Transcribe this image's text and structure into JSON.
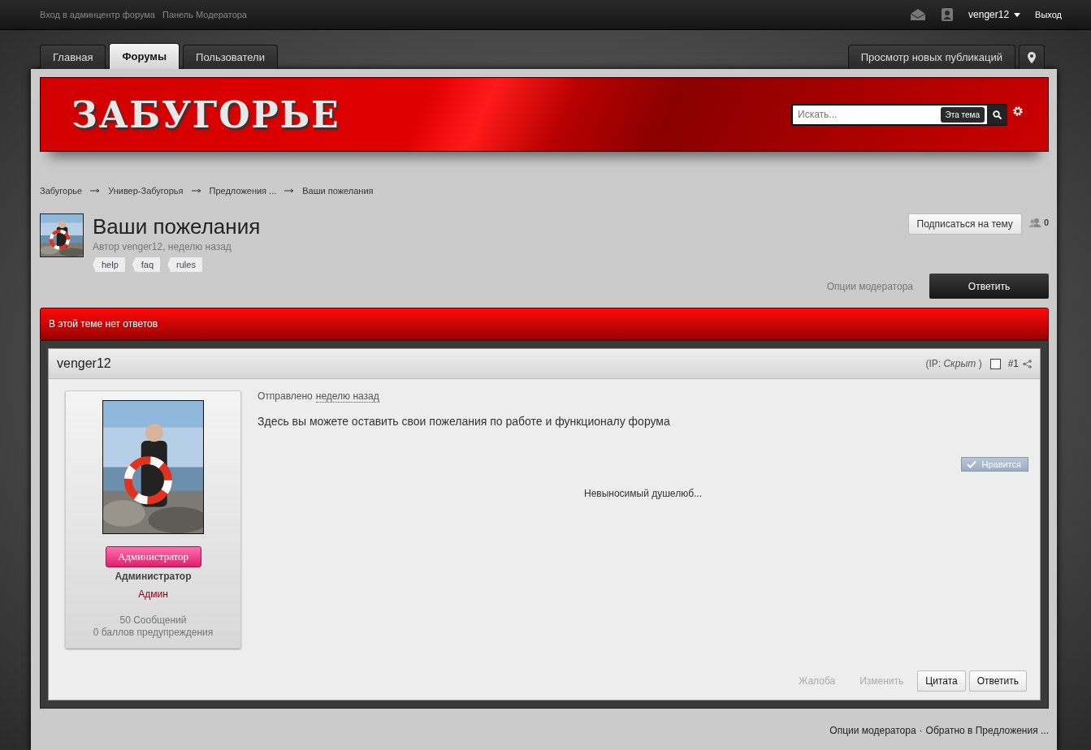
{
  "top_bar": {
    "links": [
      "Вход в админцентр форума",
      "Панель Модератора"
    ],
    "username": "venger12",
    "logout": "Выход"
  },
  "tabs": [
    {
      "label": "Главная",
      "selected": false
    },
    {
      "label": "Форумы",
      "selected": true
    },
    {
      "label": "Пользователи",
      "selected": false
    }
  ],
  "new_posts_button": "Просмотр новых публикаций",
  "header": {
    "logo": "ЗАБУГОРЬЕ",
    "search": {
      "placeholder": "Искать..."
    },
    "scope": "Эта тема"
  },
  "breadcrumbs": [
    "Забугорье",
    "Универ-Забугорья",
    "Предложения ...",
    "Ваши пожелания"
  ],
  "topic": {
    "title": "Ваши пожелания",
    "byline": "Автор venger12, неделю назад",
    "tags": [
      "help",
      "faq",
      "rules"
    ],
    "follow_button": "Подписаться на тему",
    "followers": "0",
    "mod_options": "Опции модератора",
    "reply_button": "Ответить"
  },
  "thread_bar": "В этой теме нет ответов",
  "post": {
    "author": "venger12",
    "ip": "(IP: *Скрыт* )",
    "selected": false,
    "number": "#1",
    "posted": "Отправлено",
    "posted_when": "неделю назад",
    "body": "Здесь вы можете оставить свои пожелания по работе и функционалу форума",
    "like_button": "Нравится",
    "signature": "Невыносимый душелюб...",
    "group_badge": "Администратор",
    "group": "Администратор",
    "member_title": "Админ",
    "posts_count": "50 Сообщений",
    "warnings": "0 баллов предупреждения",
    "actions": [
      {
        "label": "Жалоба",
        "kind": "link"
      },
      {
        "label": "Изменить",
        "kind": "link"
      },
      {
        "label": "Цитата",
        "kind": "button"
      },
      {
        "label": "Ответить",
        "kind": "button"
      }
    ]
  },
  "footer_links": [
    "Опции модератора",
    "Обратно в Предложения ..."
  ],
  "footer_separator": "·"
}
